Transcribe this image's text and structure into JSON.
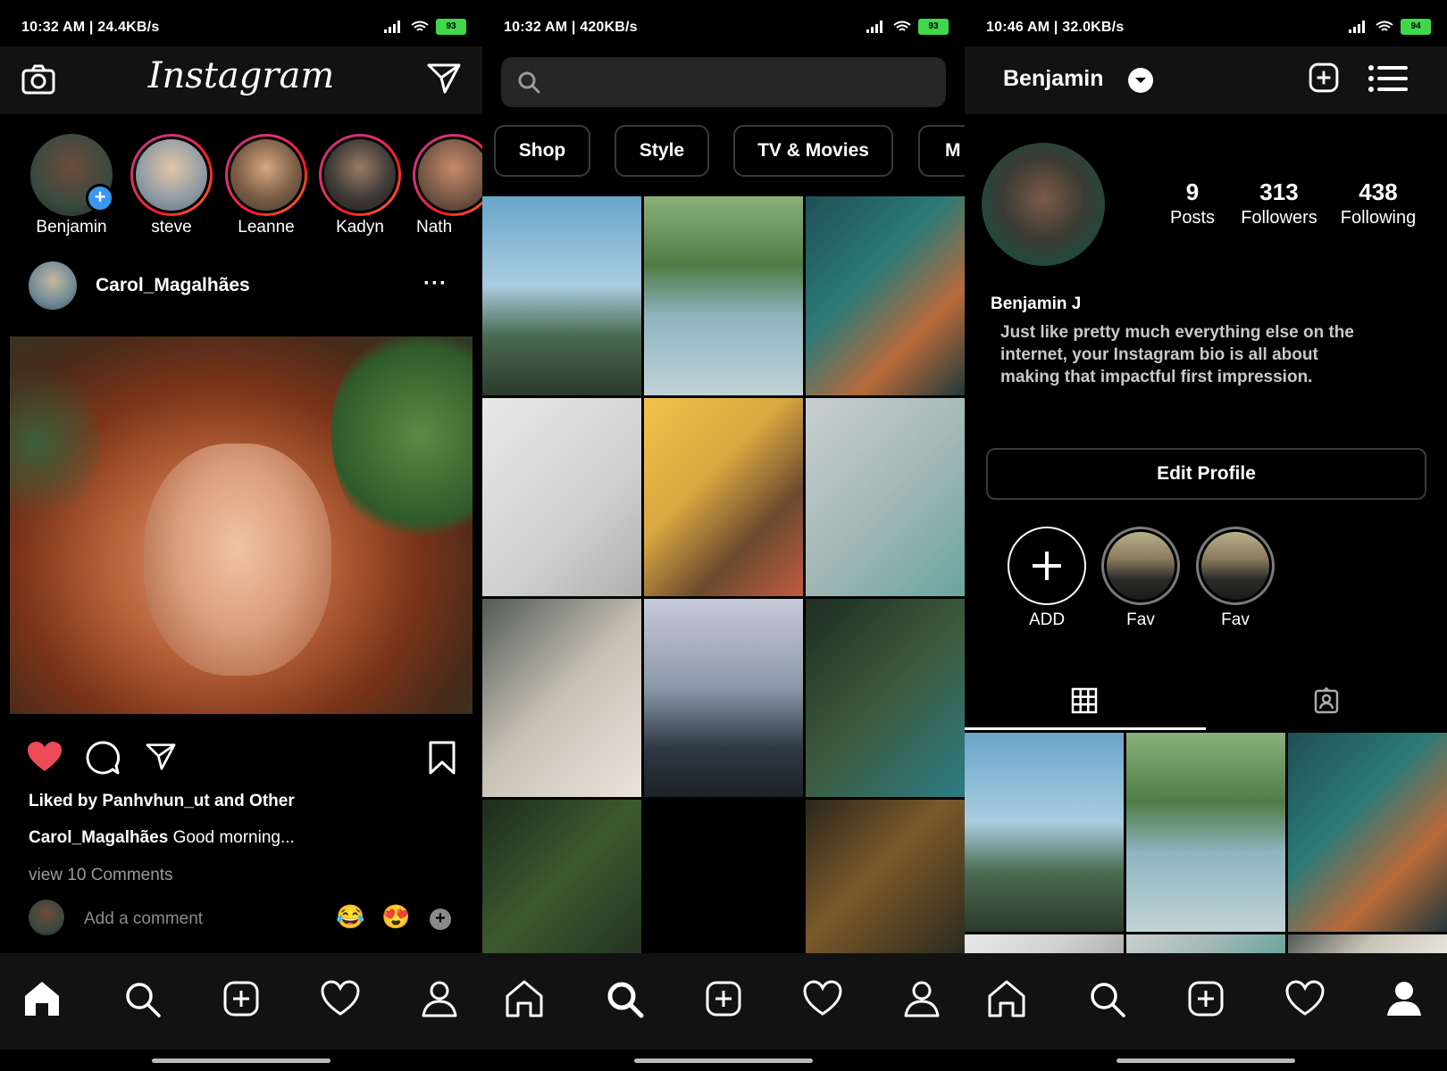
{
  "screens": [
    {
      "status": {
        "time": "10:32 AM | 24.4KB/s",
        "battery": "93"
      },
      "header": {
        "logo": "Instagram"
      },
      "stories": [
        {
          "name": "Benjamin"
        },
        {
          "name": "steve"
        },
        {
          "name": "Leanne"
        },
        {
          "name": "Kadyn"
        },
        {
          "name": "Nath"
        }
      ],
      "post": {
        "username": "Carol_Magalhães",
        "more": "···",
        "liked_prefix": "Liked by ",
        "liked_user": "Panhvhun_ut",
        "liked_mid": " and ",
        "liked_other": "Other",
        "caption_user": "Carol_Magalhães",
        "caption_text": " Good morning...",
        "view_comments": "view 10 Comments",
        "add_comment_placeholder": "Add a comment",
        "emoji_1": "😂",
        "emoji_2": "😍"
      }
    },
    {
      "status": {
        "time": "10:32 AM | 420KB/s",
        "battery": "93"
      },
      "search": {
        "placeholder": ""
      },
      "chips": [
        "Shop",
        "Style",
        "TV & Movies",
        "M"
      ]
    },
    {
      "status": {
        "time": "10:46 AM | 32.0KB/s",
        "battery": "94"
      },
      "profile": {
        "username": "Benjamin",
        "posts_count": "9",
        "posts_label": "Posts",
        "followers_count": "313",
        "followers_label": "Followers",
        "following_count": "438",
        "following_label": "Following",
        "display_name": "Benjamin J",
        "bio": "Just like pretty much everything else on the internet, your Instagram bio is all about making that impactful first impression.",
        "edit_button": "Edit Profile",
        "highlights": [
          "ADD",
          "Fav",
          "Fav"
        ]
      }
    }
  ],
  "colors": {
    "background": "#000000",
    "bar": "#121212",
    "like": "#ed4956",
    "accent_blue": "#3897f0",
    "battery_green": "#3fd84b"
  }
}
